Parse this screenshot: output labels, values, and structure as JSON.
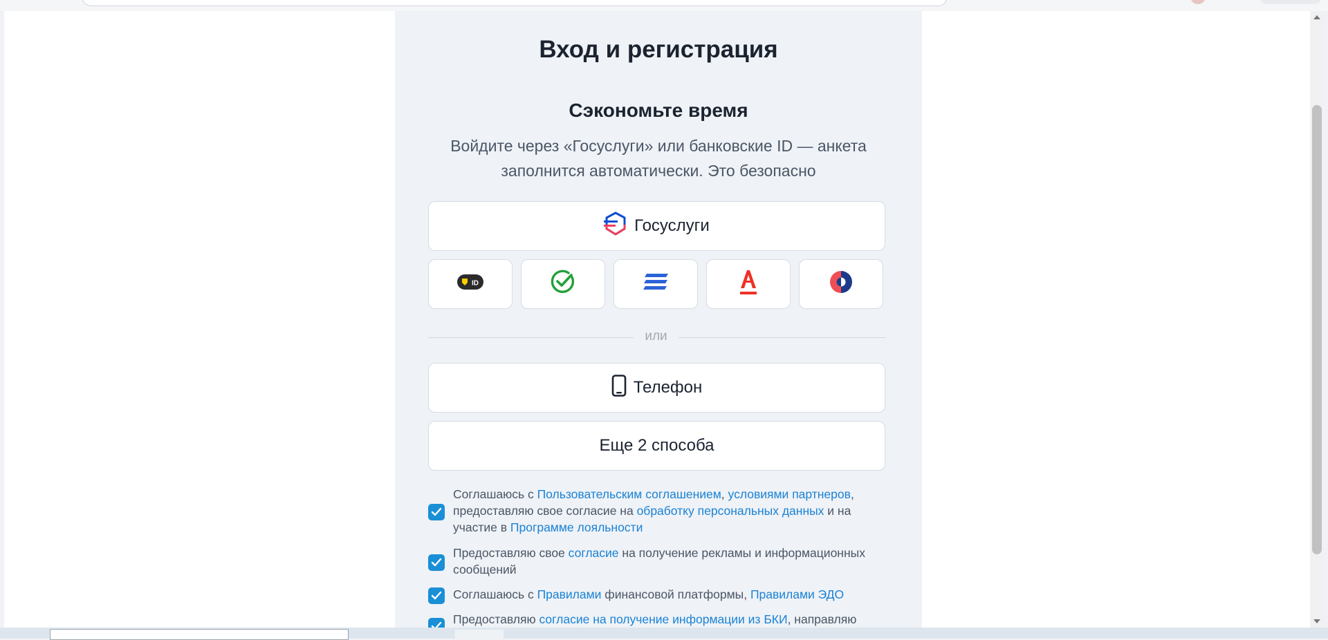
{
  "page": {
    "title": "Вход и регистрация",
    "subtitle": "Сэкономьте время",
    "description": "Войдите через «Госуслуги» или банковские ID — анкета заполнится автоматически. Это безопасно"
  },
  "buttons": {
    "gosuslugi": "Госуслуги",
    "divider": "или",
    "phone": "Телефон",
    "more": "Еще 2 способа"
  },
  "bank_ids": [
    {
      "icon": "yandex-id-icon"
    },
    {
      "icon": "sber-id-icon",
      "color": "#21a038"
    },
    {
      "icon": "tbank-id-icon",
      "color": "#2c62d8"
    },
    {
      "icon": "alfa-id-icon",
      "color": "#ef3124"
    },
    {
      "icon": "mts-id-icon",
      "color": "#1d3a8a"
    }
  ],
  "consents": [
    {
      "p1": "Соглашаюсь с ",
      "l1": "Пользовательским соглашением",
      "p2": ", ",
      "l2": "условиями партнеров",
      "p3": ", предоставляю свое согласие на ",
      "l3": "обработку персональных данных",
      "p4": " и на участие в ",
      "l4": "Программе лояльности"
    },
    {
      "p1": "Предоставляю свое ",
      "l1": "согласие",
      "p2": " на получение рекламы и информационных сообщений"
    },
    {
      "p1": "Соглашаюсь с ",
      "l1": "Правилами",
      "p2": " финансовой платформы, ",
      "l2": "Правилами ЭДО"
    },
    {
      "p1": "Предоставляю ",
      "l1": "согласие на получение информации из БКИ",
      "p2": ", направляю"
    }
  ],
  "colors": {
    "accent": "#1a8fd6",
    "link": "#1a82d6",
    "panel_bg": "#eff2f6",
    "gos_blue": "#0d4cd3",
    "gos_red": "#ee3f58"
  }
}
